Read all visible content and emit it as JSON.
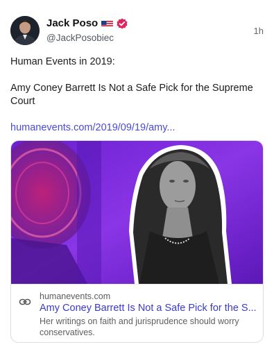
{
  "post": {
    "author": {
      "display_name": "Jack Poso",
      "flag_icon": "us-flag-icon",
      "verified_icon": "verified-badge-icon",
      "handle": "@JackPosobiec"
    },
    "timestamp": "1h",
    "body": {
      "line1": "Human Events in 2019:",
      "line2": "Amy Coney Barrett Is Not a Safe Pick for the Supreme Court",
      "link": "humanevents.com/2019/09/19/amy..."
    },
    "link_card": {
      "domain": "humanevents.com",
      "title": "Amy Coney Barrett Is Not a Safe Pick for the S...",
      "description": "Her writings on faith and jurisprudence should worry conservatives.",
      "icon": "link-icon"
    }
  },
  "colors": {
    "link": "#4a4ad8",
    "verified": "#e0245e",
    "image_bg": "#7a2bd8"
  }
}
